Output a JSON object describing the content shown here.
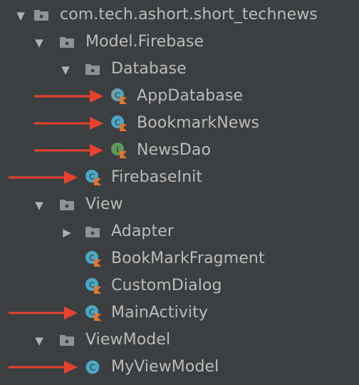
{
  "colors": {
    "background": "#3c3f41",
    "text": "#bbbbbb",
    "folder": "#8e9396",
    "class_circle": "#4aa8c2",
    "interface_circle": "#5e9959",
    "kotlin_badge": "#e8732c",
    "annotation_arrow": "#e8412c"
  },
  "tree": {
    "items": [
      {
        "label": "com.tech.ashort.short_technews",
        "icon": "package-folder-icon",
        "toggle": "expanded"
      },
      {
        "label": "Model.Firebase",
        "icon": "package-folder-icon",
        "toggle": "expanded"
      },
      {
        "label": "Database",
        "icon": "package-folder-icon",
        "toggle": "expanded"
      },
      {
        "label": "AppDatabase",
        "icon": "kotlin-abstract-class-icon",
        "annotated": true
      },
      {
        "label": "BookmarkNews",
        "icon": "kotlin-class-icon",
        "annotated": true
      },
      {
        "label": "NewsDao",
        "icon": "kotlin-interface-icon",
        "annotated": true
      },
      {
        "label": "FirebaseInit",
        "icon": "kotlin-class-icon",
        "annotated": true
      },
      {
        "label": "View",
        "icon": "package-folder-icon",
        "toggle": "expanded"
      },
      {
        "label": "Adapter",
        "icon": "package-folder-icon",
        "toggle": "collapsed"
      },
      {
        "label": "BookMarkFragment",
        "icon": "kotlin-class-icon"
      },
      {
        "label": "CustomDialog",
        "icon": "kotlin-class-icon"
      },
      {
        "label": "MainActivity",
        "icon": "kotlin-class-icon",
        "annotated": true
      },
      {
        "label": "ViewModel",
        "icon": "package-folder-icon",
        "toggle": "expanded"
      },
      {
        "label": "MyViewModel",
        "icon": "java-class-icon",
        "annotated": true
      }
    ]
  }
}
